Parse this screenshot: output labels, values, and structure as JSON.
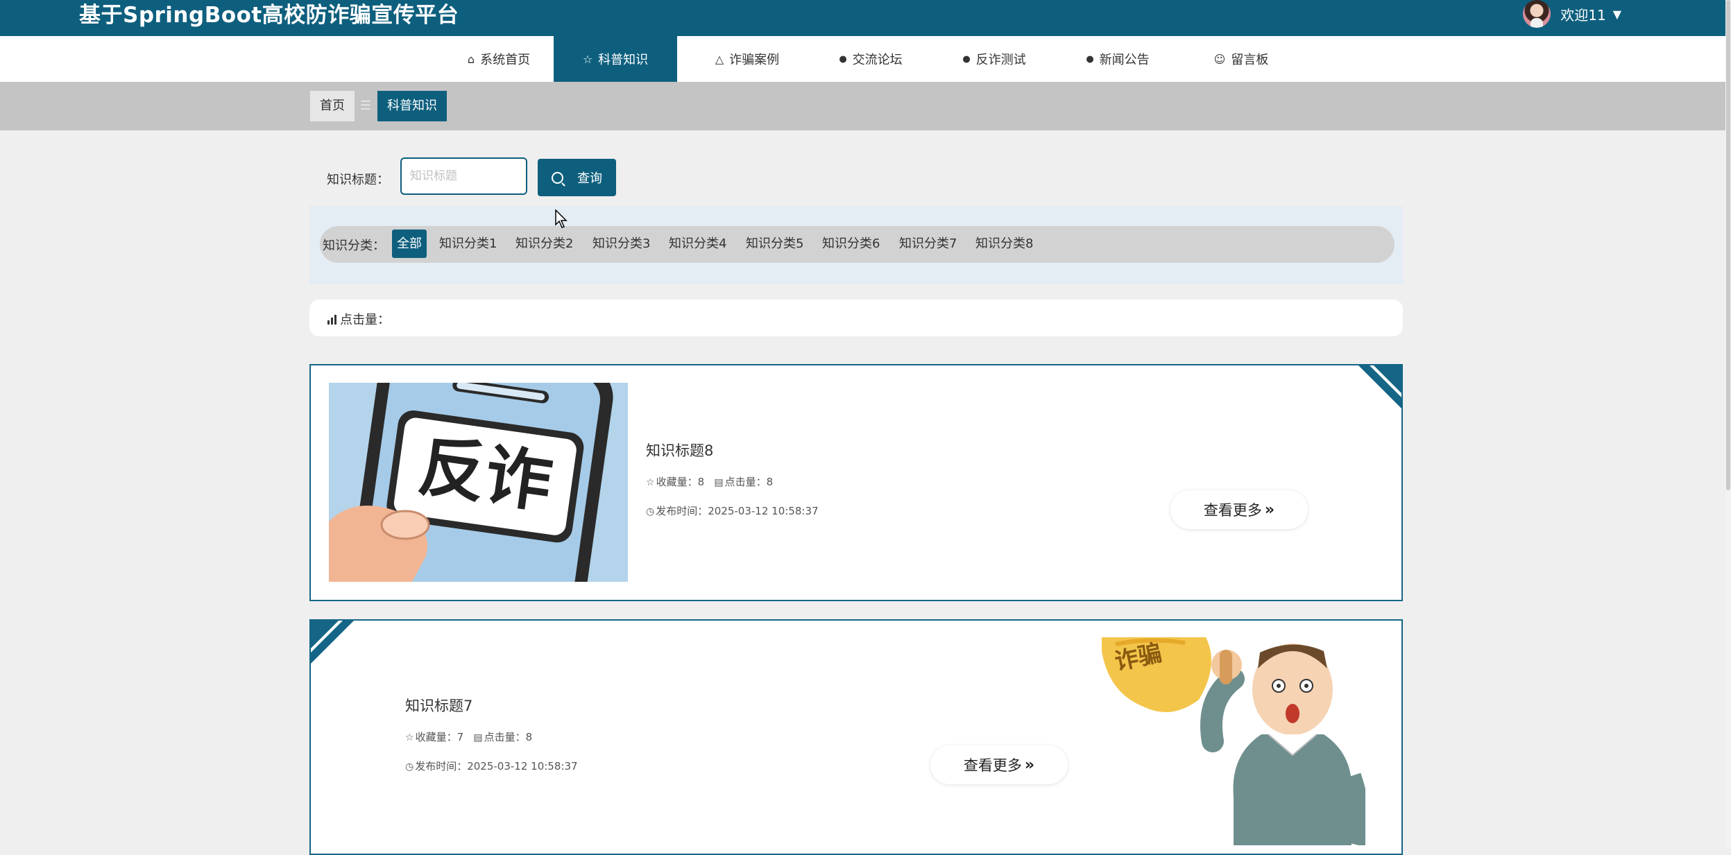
{
  "header": {
    "title": "基于SpringBoot高校防诈骗宣传平台",
    "welcome": "欢迎11",
    "caret": "▼"
  },
  "nav": {
    "items": [
      {
        "label": "系统首页",
        "icon": "home-icon",
        "glyph": "⌂"
      },
      {
        "label": "科普知识",
        "icon": "star-icon",
        "glyph": "☆"
      },
      {
        "label": "诈骗案例",
        "icon": "bag-icon",
        "glyph": "△"
      },
      {
        "label": "交流论坛",
        "icon": "alert-circle-icon",
        "glyph": "●"
      },
      {
        "label": "反诈测试",
        "icon": "question-circle-icon",
        "glyph": "●"
      },
      {
        "label": "新闻公告",
        "icon": "info-circle-icon",
        "glyph": "●"
      },
      {
        "label": "留言板",
        "icon": "smile-icon",
        "glyph": "☺"
      }
    ],
    "active_index": 1
  },
  "breadcrumb": {
    "home": "首页",
    "separator": "☰",
    "current": "科普知识"
  },
  "search": {
    "label": "知识标题：",
    "placeholder": "知识标题",
    "value": "",
    "button": "查询"
  },
  "category": {
    "label": "知识分类：",
    "items": [
      "全部",
      "知识分类1",
      "知识分类2",
      "知识分类3",
      "知识分类4",
      "知识分类5",
      "知识分类6",
      "知识分类7",
      "知识分类8"
    ],
    "active_index": 0
  },
  "click_sort": {
    "label": "点击量："
  },
  "cards": [
    {
      "title": "知识标题8",
      "favorites": "收藏量：8",
      "clicks": "点击量：8",
      "publish_time": "发布时间：2025-03-12 10:58:37",
      "more": "查看更多",
      "image_text": "反诈"
    },
    {
      "title": "知识标题7",
      "favorites": "收藏量：7",
      "clicks": "点击量：8",
      "publish_time": "发布时间：2025-03-12 10:58:37",
      "more": "查看更多",
      "image_text": "诈骗"
    }
  ],
  "colors": {
    "primary": "#0e5f7e",
    "page_bg": "#efefef",
    "breadcrumb_bg": "#c4c4c4",
    "category_panel": "#e4ecf4"
  }
}
